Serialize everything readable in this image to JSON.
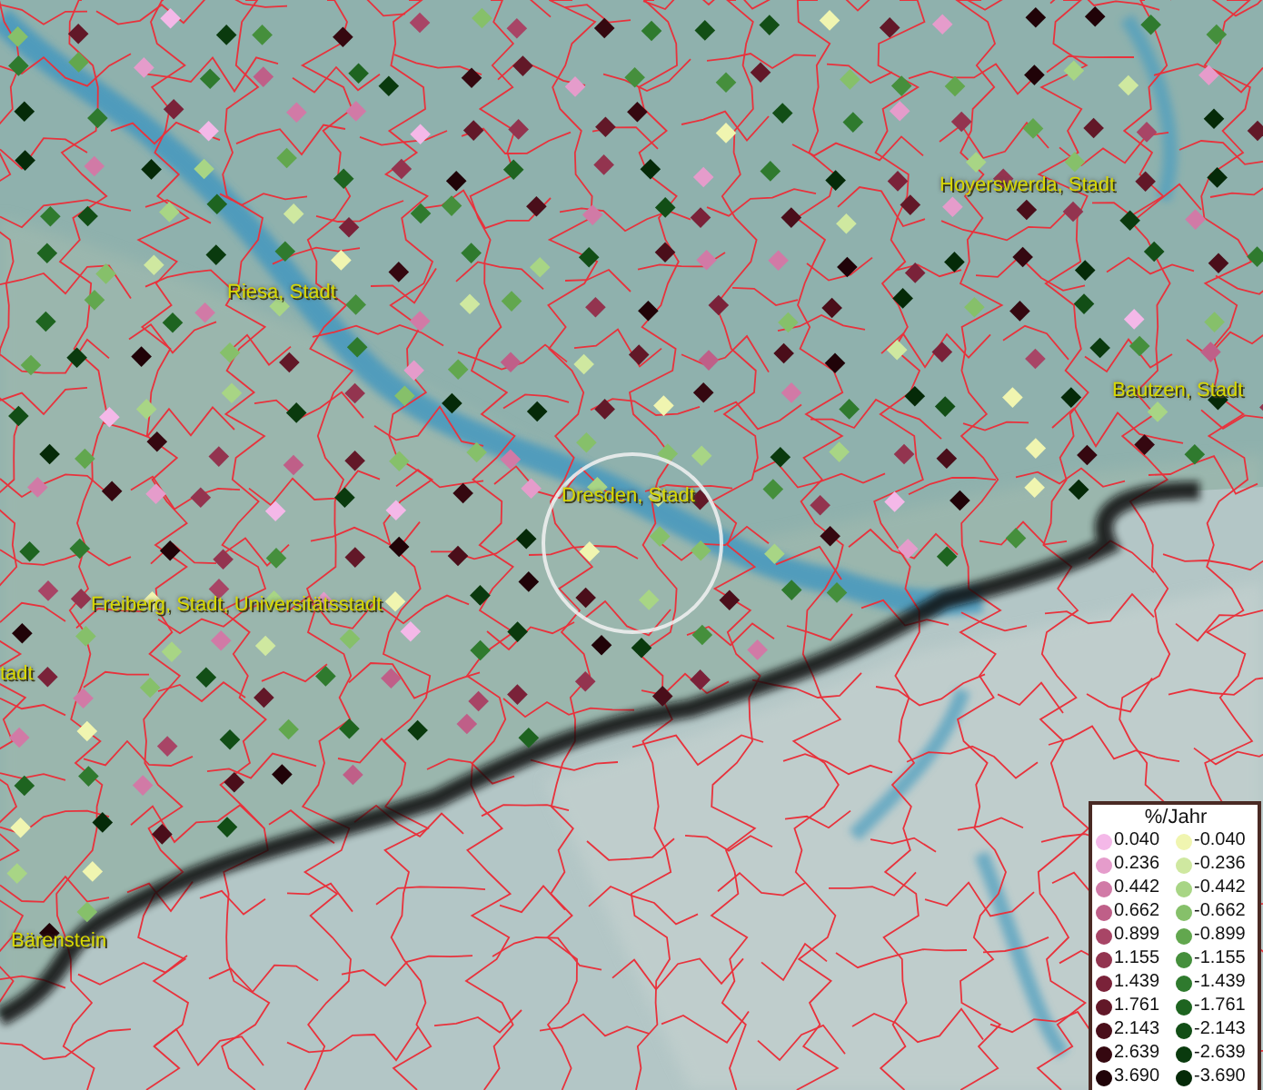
{
  "map": {
    "places": [
      {
        "name": "Hoyerswerda, Stadt"
      },
      {
        "name": "Riesa, Stadt"
      },
      {
        "name": "Bautzen, Stadt"
      },
      {
        "name": "Dresden, Stadt"
      },
      {
        "name": "Freiberg, Stadt, Universitätsstadt"
      },
      {
        "name": "tadt"
      },
      {
        "name": "Bärenstein"
      }
    ]
  },
  "legend": {
    "title": "%/Jahr",
    "positive": [
      {
        "label": "0.040",
        "color": "#f4b8e8"
      },
      {
        "label": "0.236",
        "color": "#e59ccb"
      },
      {
        "label": "0.442",
        "color": "#d17aa6"
      },
      {
        "label": "0.662",
        "color": "#bf5f88"
      },
      {
        "label": "0.899",
        "color": "#a84566"
      },
      {
        "label": "1.155",
        "color": "#93344f"
      },
      {
        "label": "1.439",
        "color": "#7a2239"
      },
      {
        "label": "1.761",
        "color": "#621828"
      },
      {
        "label": "2.143",
        "color": "#4a0e1a"
      },
      {
        "label": "2.639",
        "color": "#350810"
      },
      {
        "label": "3.690",
        "color": "#200308"
      }
    ],
    "negative": [
      {
        "label": "-0.040",
        "color": "#f0f5b0"
      },
      {
        "label": "-0.236",
        "color": "#cfe8a0"
      },
      {
        "label": "-0.442",
        "color": "#a8d585"
      },
      {
        "label": "-0.662",
        "color": "#86c06a"
      },
      {
        "label": "-0.899",
        "color": "#62a74e"
      },
      {
        "label": "-1.155",
        "color": "#458f3c"
      },
      {
        "label": "-1.439",
        "color": "#2f7a2e"
      },
      {
        "label": "-1.761",
        "color": "#1e6420"
      },
      {
        "label": "-2.143",
        "color": "#124e16"
      },
      {
        "label": "-2.639",
        "color": "#0a3a0e"
      },
      {
        "label": "-3.690",
        "color": "#052a08"
      }
    ]
  }
}
